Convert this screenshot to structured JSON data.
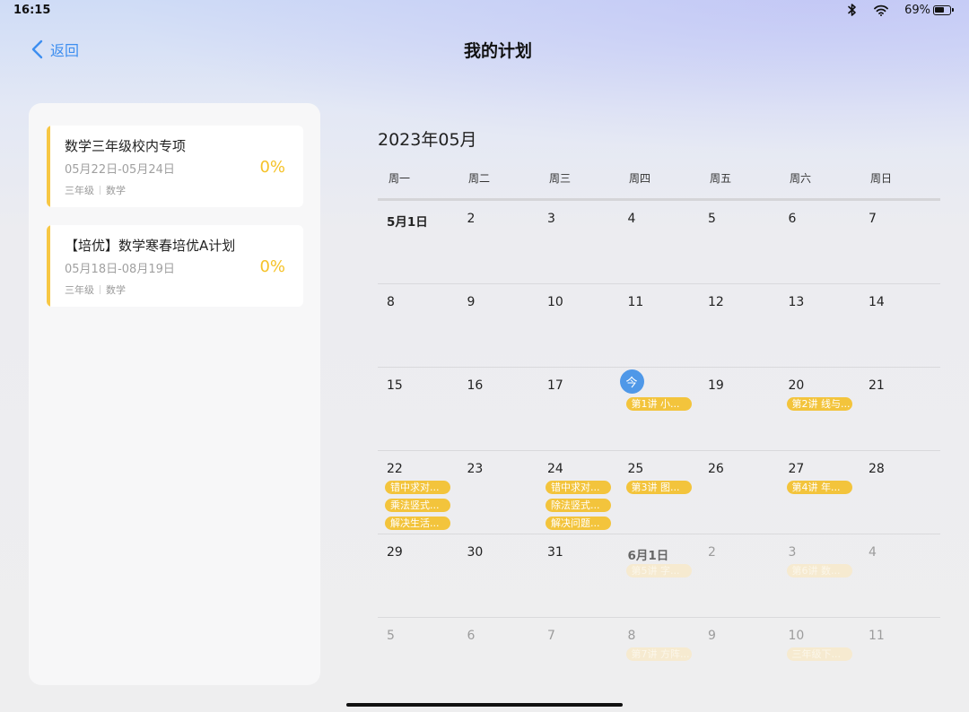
{
  "status": {
    "time": "16:15",
    "battery_text": "69%",
    "battery_level": 0.69
  },
  "header": {
    "back_label": "返回",
    "title": "我的计划"
  },
  "plans": [
    {
      "title": "数学三年级校内专项",
      "date_range": "05月22日-05月24日",
      "grade": "三年级",
      "subject": "数学",
      "progress": "0%"
    },
    {
      "title": "【培优】数学寒春培优A计划",
      "date_range": "05月18日-08月19日",
      "grade": "三年级",
      "subject": "数学",
      "progress": "0%"
    }
  ],
  "calendar": {
    "month_label": "2023年05月",
    "weekdays": [
      "周一",
      "周二",
      "周三",
      "周四",
      "周五",
      "周六",
      "周日"
    ],
    "today_label": "今",
    "weeks": [
      [
        {
          "day": "5月1日",
          "style": "bold"
        },
        {
          "day": "2"
        },
        {
          "day": "3"
        },
        {
          "day": "4"
        },
        {
          "day": "5"
        },
        {
          "day": "6"
        },
        {
          "day": "7"
        }
      ],
      [
        {
          "day": "8"
        },
        {
          "day": "9"
        },
        {
          "day": "10"
        },
        {
          "day": "11"
        },
        {
          "day": "12"
        },
        {
          "day": "13"
        },
        {
          "day": "14"
        }
      ],
      [
        {
          "day": "15"
        },
        {
          "day": "16"
        },
        {
          "day": "17"
        },
        {
          "day": "18",
          "today": true,
          "events": [
            "第1讲 小..."
          ]
        },
        {
          "day": "19"
        },
        {
          "day": "20",
          "events": [
            "第2讲 线与..."
          ]
        },
        {
          "day": "21"
        }
      ],
      [
        {
          "day": "22",
          "events": [
            "错中求对...",
            "乘法竖式...",
            "解决生活..."
          ]
        },
        {
          "day": "23"
        },
        {
          "day": "24",
          "events": [
            "错中求对...",
            "除法竖式...",
            "解决问题..."
          ]
        },
        {
          "day": "25",
          "events": [
            "第3讲 图..."
          ]
        },
        {
          "day": "26"
        },
        {
          "day": "27",
          "events": [
            "第4讲 年..."
          ]
        },
        {
          "day": "28"
        }
      ],
      [
        {
          "day": "29"
        },
        {
          "day": "30"
        },
        {
          "day": "31"
        },
        {
          "day": "6月1日",
          "style": "next-bold",
          "events_faded": [
            "第5讲 字..."
          ]
        },
        {
          "day": "2",
          "style": "other"
        },
        {
          "day": "3",
          "style": "other",
          "events_faded": [
            "第6讲 数..."
          ]
        },
        {
          "day": "4",
          "style": "other"
        }
      ],
      [
        {
          "day": "5",
          "style": "other"
        },
        {
          "day": "6",
          "style": "other"
        },
        {
          "day": "7",
          "style": "other"
        },
        {
          "day": "8",
          "style": "other",
          "events_faded": [
            "第7讲 方阵..."
          ]
        },
        {
          "day": "9",
          "style": "other"
        },
        {
          "day": "10",
          "style": "other",
          "events_faded": [
            "三年级下..."
          ]
        },
        {
          "day": "11",
          "style": "other"
        }
      ]
    ]
  },
  "colors": {
    "accent": "#3d8ef0",
    "today": "#4f98e8",
    "event": "#f3c43c",
    "progress": "#f5c228"
  }
}
